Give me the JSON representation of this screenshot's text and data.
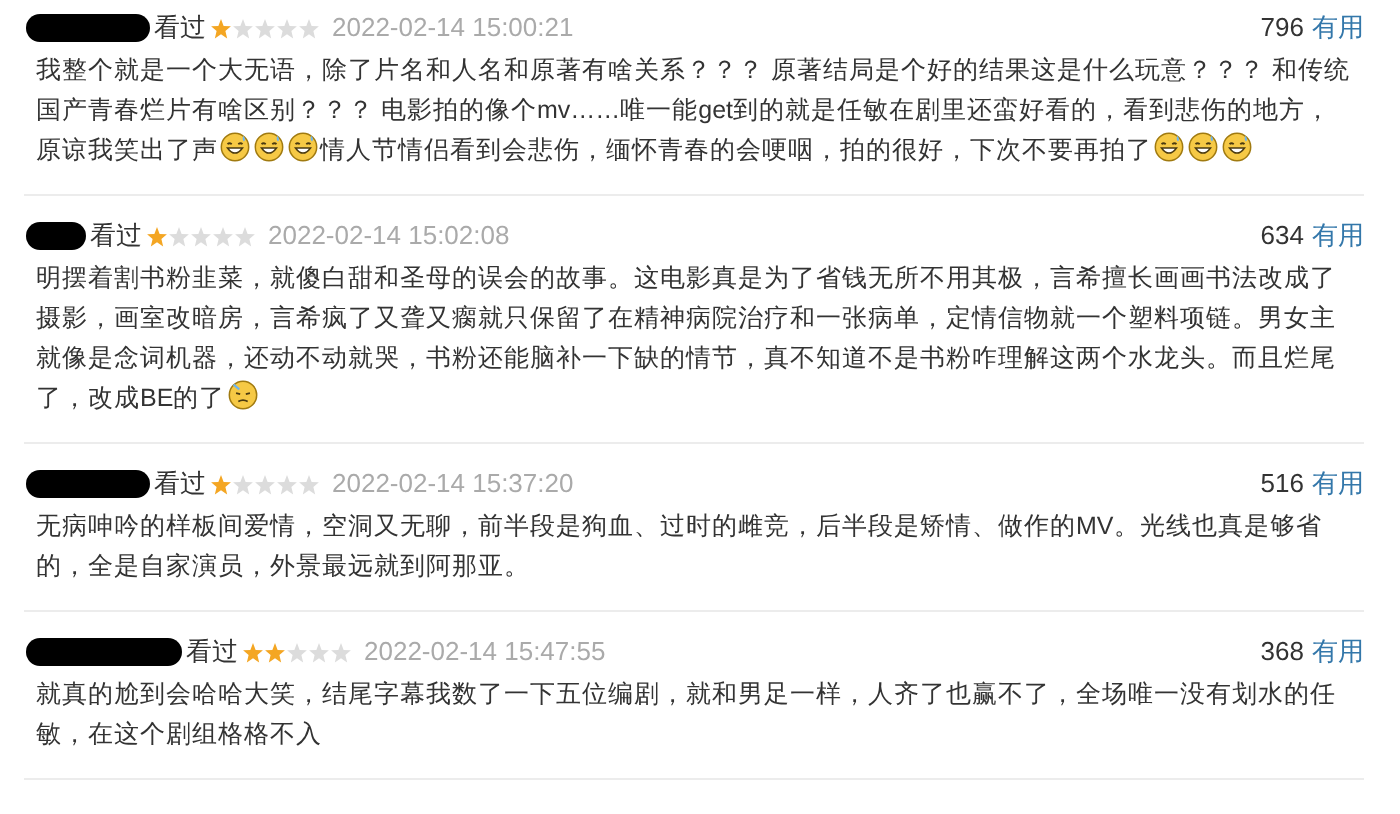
{
  "reviews": [
    {
      "status": "看过",
      "stars": 1,
      "time": "2022-02-14 15:00:21",
      "votes": "796",
      "vote_label": "有用",
      "body": [
        {
          "kind": "text",
          "text": "我整个就是一个大无语，除了片名和人名和原著有啥关系？？？ 原著结局是个好的结果这是什么玩意？？？ 和传统国产青春烂片有啥区别？？？ 电影拍的像个mv……唯一能get到的就是任敏在剧里还蛮好看的，看到悲伤的地方，原谅我笑出了声"
        },
        {
          "kind": "grin"
        },
        {
          "kind": "grin"
        },
        {
          "kind": "grin"
        },
        {
          "kind": "text",
          "text": "情人节情侣看到会悲伤，缅怀青春的会哽咽，拍的很好，下次不要再拍了"
        },
        {
          "kind": "grin"
        },
        {
          "kind": "grin"
        },
        {
          "kind": "grin"
        }
      ]
    },
    {
      "status": "看过",
      "stars": 1,
      "time": "2022-02-14 15:02:08",
      "votes": "634",
      "vote_label": "有用",
      "body": [
        {
          "kind": "text",
          "text": "明摆着割书粉韭菜，就傻白甜和圣母的误会的故事。这电影真是为了省钱无所不用其极，言希擅长画画书法改成了摄影，画室改暗房，言希疯了又聋又瘸就只保留了在精神病院治疗和一张病单，定情信物就一个塑料项链。男女主就像是念词机器，还动不动就哭，书粉还能脑补一下缺的情节，真不知道不是书粉咋理解这两个水龙头。而且烂尾了，改成BE的了"
        },
        {
          "kind": "sad"
        }
      ]
    },
    {
      "status": "看过",
      "stars": 1,
      "time": "2022-02-14 15:37:20",
      "votes": "516",
      "vote_label": "有用",
      "body": [
        {
          "kind": "text",
          "text": "无病呻吟的样板间爱情，空洞又无聊，前半段是狗血、过时的雌竞，后半段是矫情、做作的MV。光线也真是够省的，全是自家演员，外景最远就到阿那亚。"
        }
      ]
    },
    {
      "status": "看过",
      "stars": 2,
      "time": "2022-02-14 15:47:55",
      "votes": "368",
      "vote_label": "有用",
      "body": [
        {
          "kind": "text",
          "text": "就真的尬到会哈哈大笑，结尾字幕我数了一下五位编剧，就和男足一样，人齐了也赢不了，全场唯一没有划水的任敏，在这个剧组格格不入"
        }
      ]
    }
  ]
}
